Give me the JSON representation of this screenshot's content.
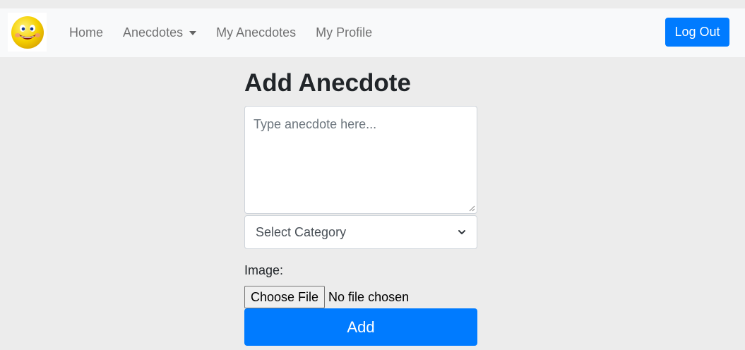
{
  "navbar": {
    "logo_icon": "smiley-face-icon",
    "links": [
      {
        "label": "Home"
      },
      {
        "label": "Anecdotes"
      },
      {
        "label": "My Anecdotes"
      },
      {
        "label": "My Profile"
      }
    ],
    "logout_label": "Log Out"
  },
  "form": {
    "title": "Add Anecdote",
    "anecdote_placeholder": "Type anecdote here...",
    "category_selected": "Select Category",
    "image_label": "Image:",
    "choose_file_label": "Choose File",
    "file_status": "No file chosen",
    "submit_label": "Add"
  },
  "colors": {
    "primary": "#007bff",
    "navbar_bg": "#f8f9fa",
    "page_bg": "#ececec"
  }
}
